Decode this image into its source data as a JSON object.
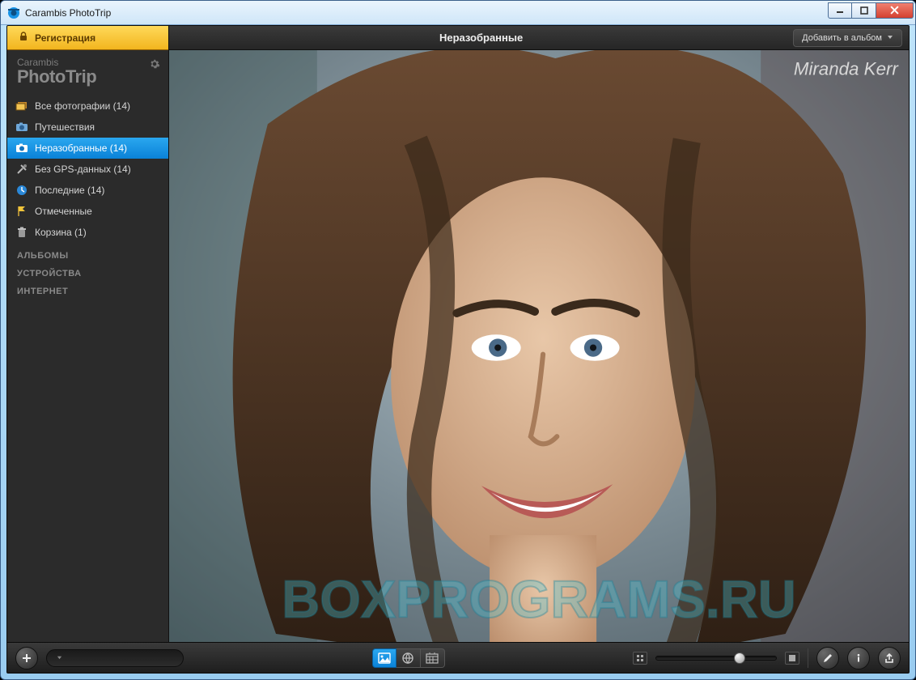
{
  "window": {
    "title": "Carambis PhotoTrip"
  },
  "registration": {
    "label": "Регистрация"
  },
  "brand": {
    "line1": "Carambis",
    "line2": "PhotoTrip"
  },
  "nav": [
    {
      "key": "all",
      "icon": "stack-icon",
      "label": "Все фотографии (14)"
    },
    {
      "key": "trips",
      "icon": "camera-icon",
      "label": "Путешествия"
    },
    {
      "key": "unsorted",
      "icon": "camera-icon",
      "label": "Неразобранные (14)",
      "active": true
    },
    {
      "key": "nogps",
      "icon": "tools-icon",
      "label": "Без GPS-данных (14)"
    },
    {
      "key": "recent",
      "icon": "clock-icon",
      "label": "Последние (14)"
    },
    {
      "key": "flagged",
      "icon": "flag-icon",
      "label": "Отмеченные"
    },
    {
      "key": "trash",
      "icon": "trash-icon",
      "label": "Корзина (1)"
    }
  ],
  "categories": [
    {
      "key": "albums",
      "label": "АЛЬБОМЫ"
    },
    {
      "key": "devices",
      "label": "УСТРОЙСТВА"
    },
    {
      "key": "internet",
      "label": "ИНТЕРНЕТ"
    }
  ],
  "header": {
    "title": "Неразобранные",
    "add_to_album": "Добавить в альбом"
  },
  "footer": {
    "search_placeholder": "",
    "zoom_percent": 65
  },
  "watermark": "BOXPROGRAMS.RU",
  "signature": "Miranda Kerr",
  "colors": {
    "accent": "#1793e6",
    "registration": "#f6bd24"
  }
}
